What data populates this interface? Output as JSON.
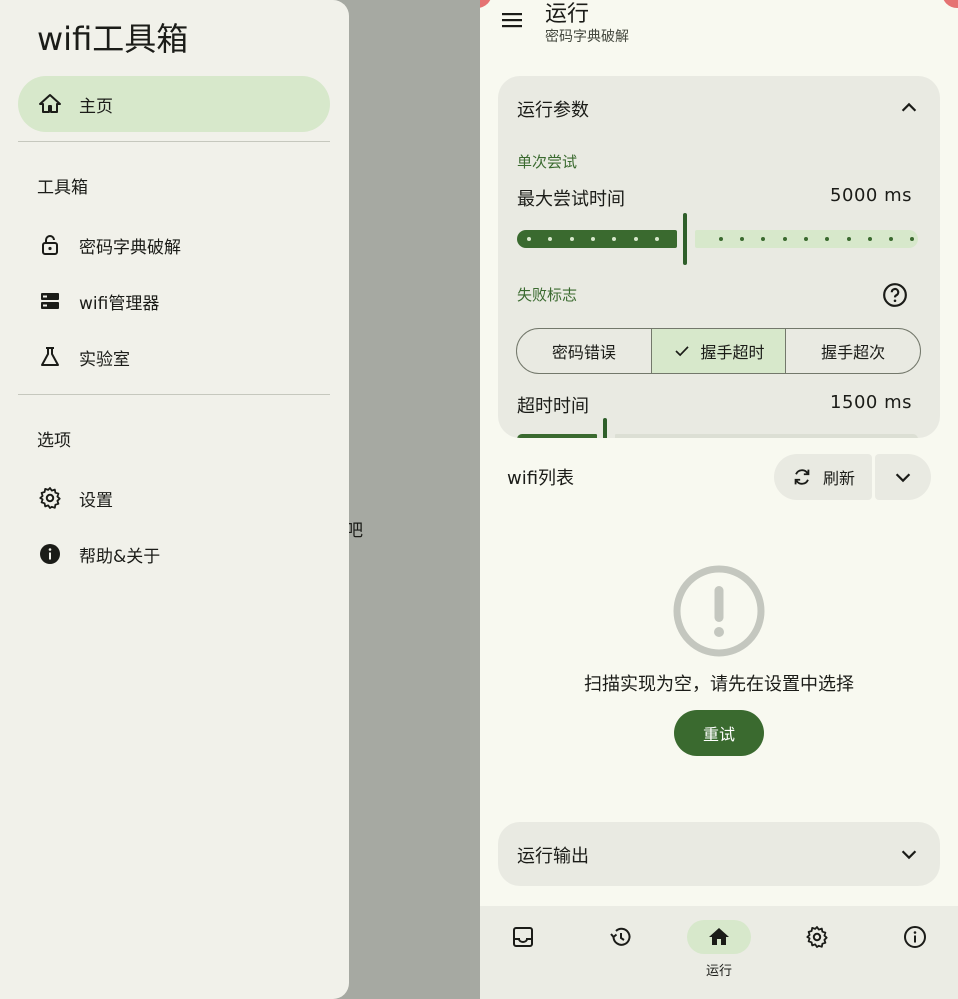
{
  "drawer": {
    "title": "wifi工具箱",
    "home": "主页",
    "section_tools": "工具箱",
    "tools": [
      "密码字典破解",
      "wifi管理器",
      "实验室"
    ],
    "section_options": "选项",
    "options": [
      "设置",
      "帮助&关于"
    ]
  },
  "scrim_text": "吧",
  "app": {
    "title": "运行",
    "subtitle": "密码字典破解"
  },
  "params": {
    "header": "运行参数",
    "single_try_label": "单次尝试",
    "max_time_label": "最大尝试时间",
    "max_time_value": "5000 ms",
    "max_time_fraction": 0.42,
    "fail_flag_label": "失败标志",
    "fail_options": [
      "密码错误",
      "握手超时",
      "握手超次"
    ],
    "fail_selected": 1,
    "timeout_label": "超时时间",
    "timeout_value": "1500 ms",
    "timeout_fraction": 0.22
  },
  "wifi": {
    "title": "wifi列表",
    "refresh": "刷新",
    "empty_text": "扫描实现为空，请先在设置中选择",
    "retry": "重试"
  },
  "output": {
    "header": "运行输出"
  },
  "bottom_nav": {
    "items": [
      "inbox-icon",
      "history-icon",
      "home-icon",
      "settings-icon",
      "info-icon"
    ],
    "active_label": "运行"
  },
  "colors": {
    "primary": "#3a6a2f",
    "secondary_container": "#d7e8cb",
    "surface": "#f8f9f0",
    "card": "#e9eae2"
  }
}
